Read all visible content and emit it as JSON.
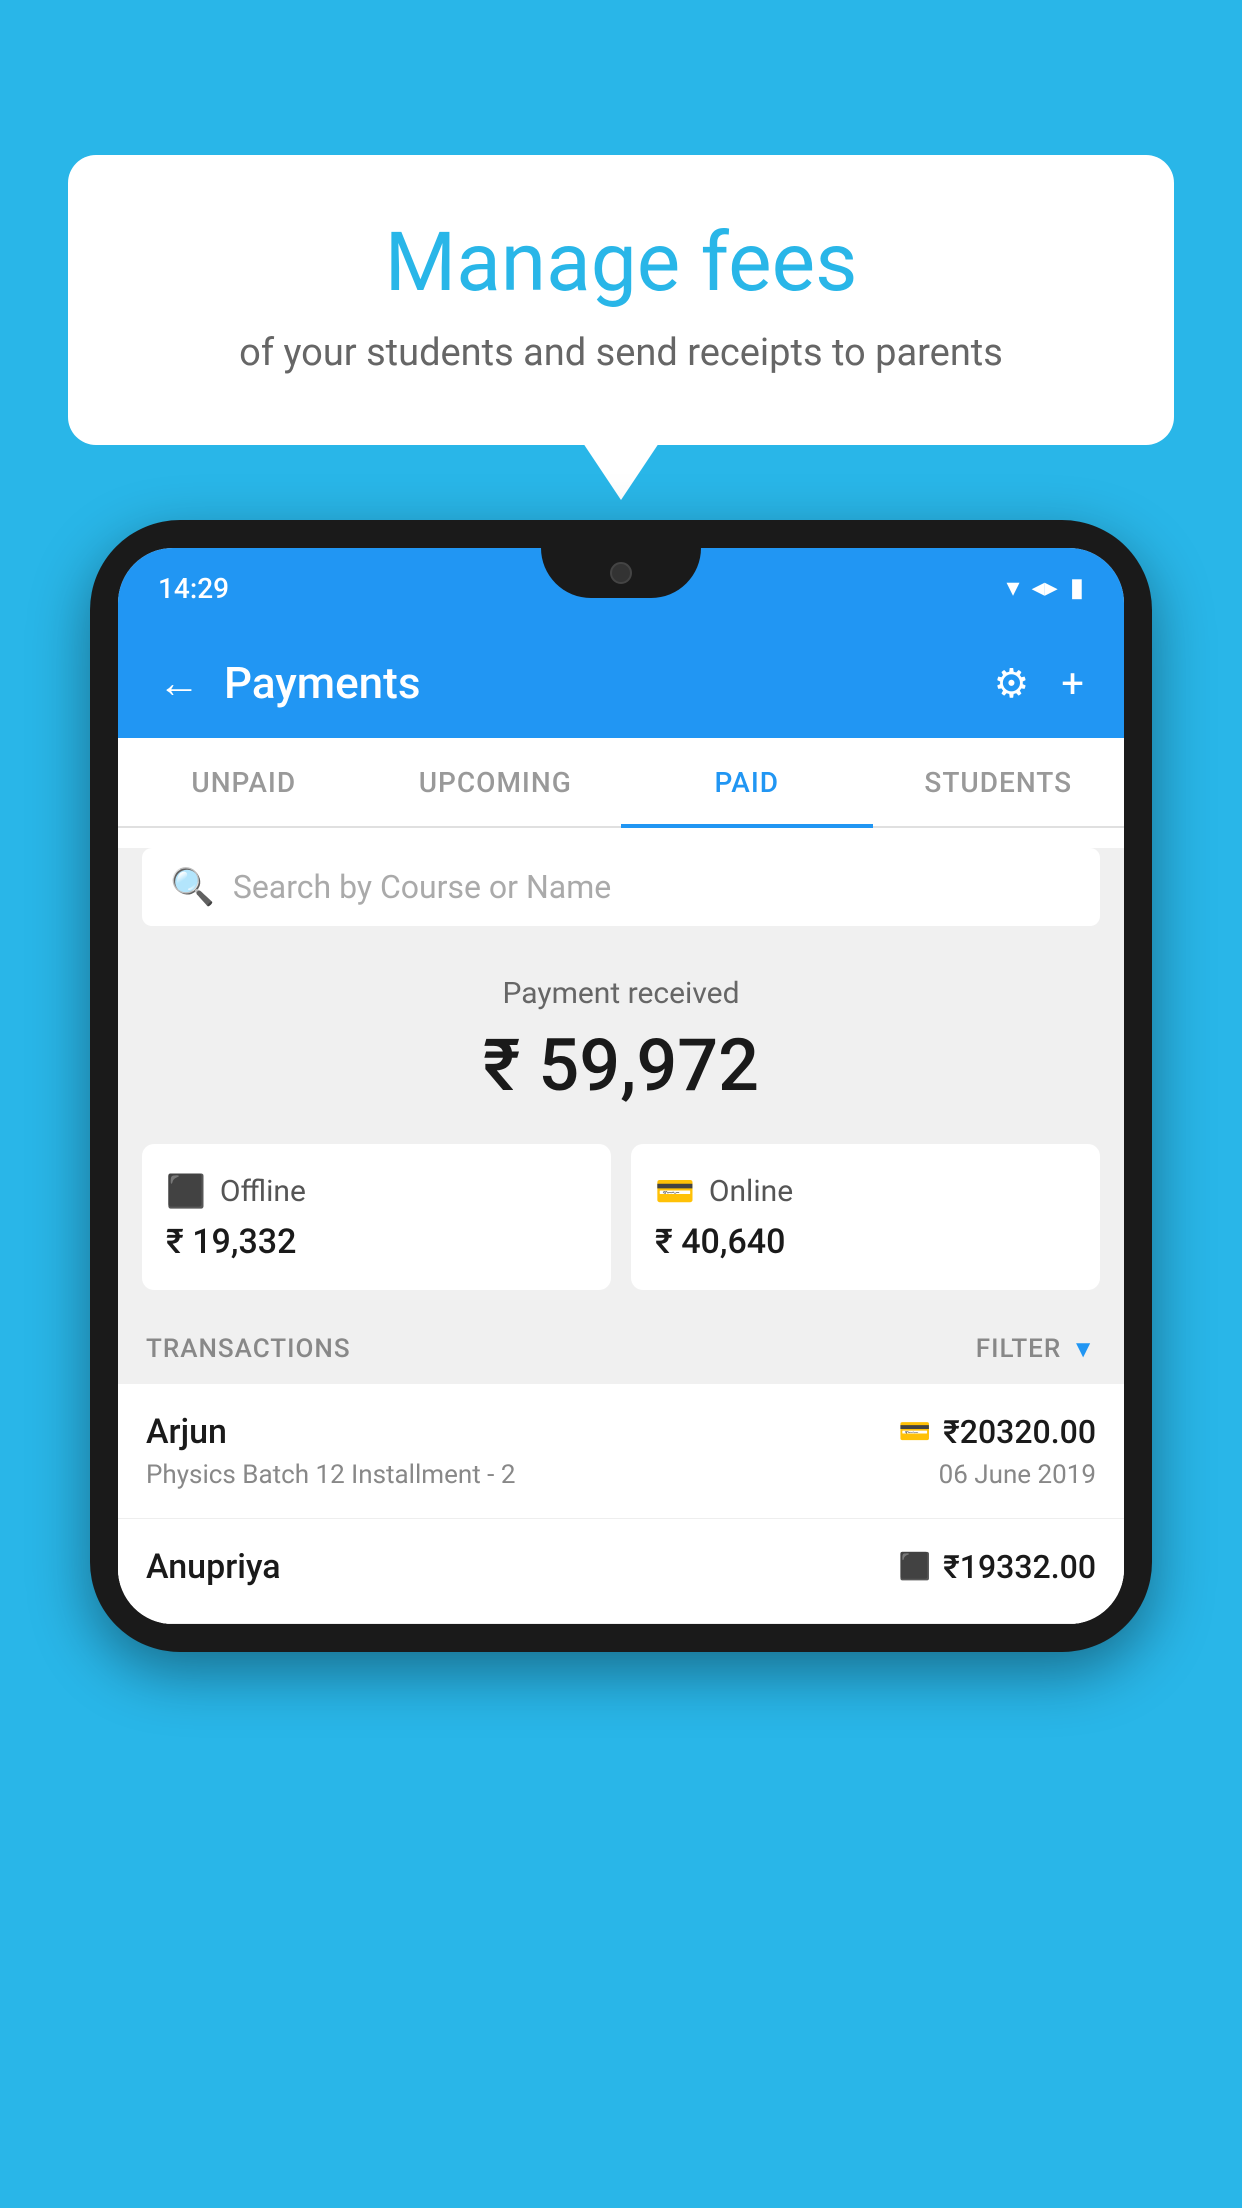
{
  "background_color": "#29b6e8",
  "bubble": {
    "title": "Manage fees",
    "subtitle": "of your students and send receipts to parents"
  },
  "status_bar": {
    "time": "14:29",
    "wifi": "▾",
    "signal": "▲",
    "battery": "▮"
  },
  "header": {
    "title": "Payments",
    "back_label": "←",
    "gear_label": "⚙",
    "plus_label": "+"
  },
  "tabs": [
    {
      "label": "UNPAID",
      "active": false
    },
    {
      "label": "UPCOMING",
      "active": false
    },
    {
      "label": "PAID",
      "active": true
    },
    {
      "label": "STUDENTS",
      "active": false
    }
  ],
  "search": {
    "placeholder": "Search by Course or Name"
  },
  "payment_received": {
    "label": "Payment received",
    "amount": "₹ 59,972"
  },
  "payment_cards": [
    {
      "icon": "offline",
      "label": "Offline",
      "amount": "₹ 19,332"
    },
    {
      "icon": "online",
      "label": "Online",
      "amount": "₹ 40,640"
    }
  ],
  "transactions_section": {
    "label": "TRANSACTIONS",
    "filter_label": "FILTER"
  },
  "transactions": [
    {
      "name": "Arjun",
      "type_icon": "card",
      "amount": "₹20320.00",
      "detail": "Physics Batch 12 Installment - 2",
      "date": "06 June 2019"
    },
    {
      "name": "Anupriya",
      "type_icon": "cash",
      "amount": "₹19332.00",
      "detail": "",
      "date": ""
    }
  ]
}
